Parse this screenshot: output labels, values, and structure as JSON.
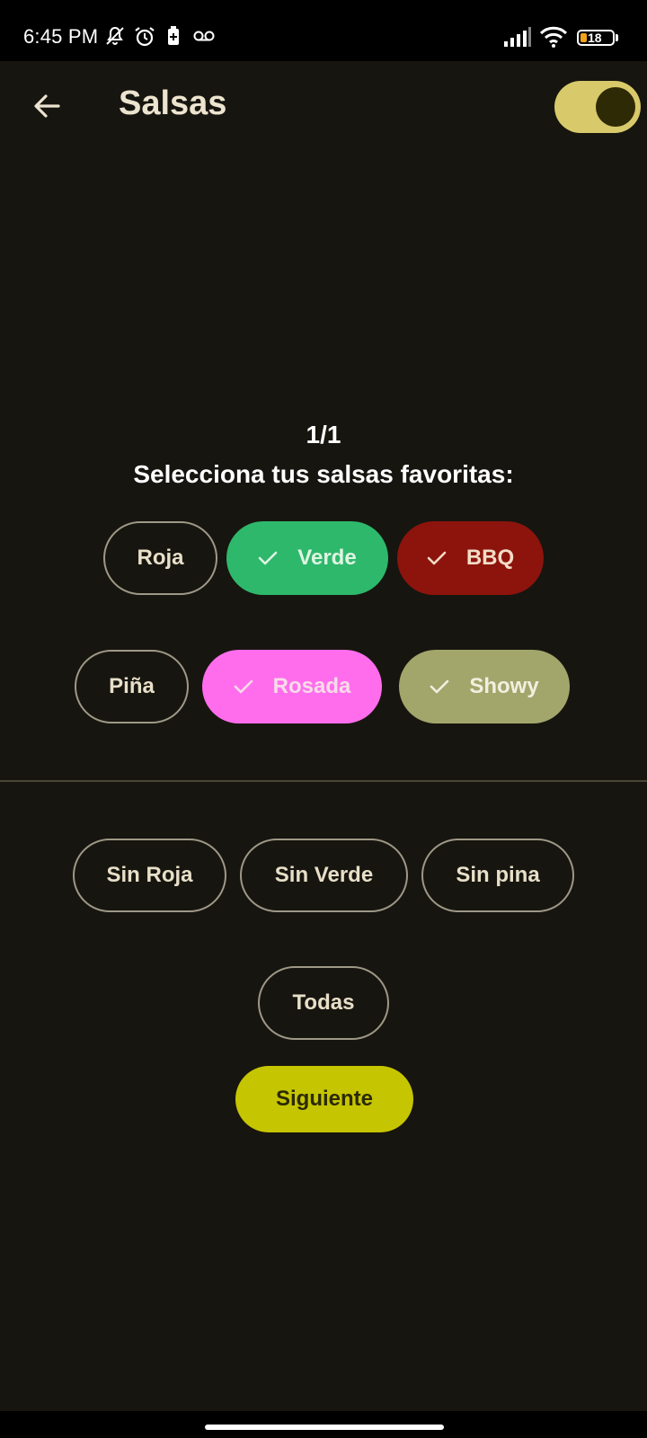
{
  "status_bar": {
    "time": "6:45 PM",
    "battery_level": "18",
    "icons": [
      "notifications-off-icon",
      "alarm-icon",
      "battery-saver-icon",
      "voicemail-icon",
      "signal-icon",
      "wifi-icon",
      "battery-icon"
    ]
  },
  "app_bar": {
    "title": "Salsas",
    "back_icon": "arrow-back-icon",
    "theme_toggle_on": true
  },
  "question": {
    "step": "1/1",
    "prompt": "Selecciona tus salsas favoritas:"
  },
  "salsas": [
    {
      "label": "Roja",
      "selected": false
    },
    {
      "label": "Verde",
      "selected": true,
      "color": "#2eb86b",
      "text_color": "#dff5e3"
    },
    {
      "label": "BBQ",
      "selected": true,
      "color": "#8c140d",
      "text_color": "#f3dcc6"
    },
    {
      "label": "Piña",
      "selected": false
    },
    {
      "label": "Rosada",
      "selected": true,
      "color": "#ff6ded",
      "text_color": "#f8dbe8"
    },
    {
      "label": "Showy",
      "selected": true,
      "color": "#a2a66b",
      "text_color": "#f2efe0"
    }
  ],
  "exclusions": [
    {
      "label": "Sin Roja",
      "selected": false
    },
    {
      "label": "Sin Verde",
      "selected": false
    },
    {
      "label": "Sin pina",
      "selected": false
    },
    {
      "label": "Todas",
      "selected": false
    }
  ],
  "next_button": {
    "label": "Siguiente",
    "color": "#c6c501"
  }
}
